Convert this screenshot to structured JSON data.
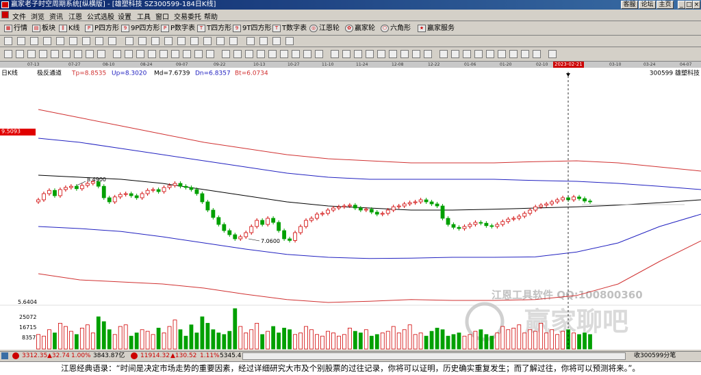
{
  "window": {
    "title": "赢家老子时空周期系统[纵横版] - [雄塑科技  SZ300599-184日K线]",
    "right_buttons": [
      "客服",
      "论坛",
      "主页"
    ],
    "controls": [
      "_",
      "□",
      "×"
    ]
  },
  "menu": [
    "文件",
    "浏览",
    "资讯",
    "江恩",
    "公式选股",
    "设置",
    "工具",
    "窗口",
    "交易委托",
    "帮助"
  ],
  "toolbar1": [
    {
      "icon": "table-icon",
      "label": "行情"
    },
    {
      "icon": "blocks-icon",
      "label": "板块"
    },
    {
      "icon": "kline-icon",
      "label": "K线"
    },
    {
      "icon": "p-square-icon",
      "label": "P四方形"
    },
    {
      "icon": "9p-square-icon",
      "label": "9P四方形"
    },
    {
      "icon": "p-table-icon",
      "label": "P数字表"
    },
    {
      "icon": "t-square-icon",
      "label": "T四方形"
    },
    {
      "icon": "9t-square-icon",
      "label": "9T四方形"
    },
    {
      "icon": "t-table-icon",
      "label": "T数字表"
    },
    {
      "icon": "gann-wheel-icon",
      "label": "江恩轮"
    },
    {
      "icon": "winner-wheel-icon",
      "label": "赢家轮"
    },
    {
      "icon": "hexagon-icon",
      "label": "六角形"
    },
    {
      "icon": "service-icon",
      "label": "赢家服务"
    }
  ],
  "dates": [
    "07-13",
    "07-27",
    "08-10",
    "08-24",
    "09-07",
    "09-22",
    "10-13",
    "10-27",
    "11-10",
    "11-24",
    "12-08",
    "12-22",
    "01-06",
    "01-20",
    "02-10",
    "2023-02-21",
    "03-10",
    "03-24",
    "04-07"
  ],
  "chart_data": {
    "type": "candlestick",
    "period_label": "日K线",
    "indicator": "极反通道",
    "values": {
      "Tp": "Tp=8.8535",
      "Up": "Up=8.3020",
      "Md": "Md=7.6739",
      "Dn": "Dn=6.8357",
      "Bt": "Bt=6.0734"
    },
    "stock": "300599  雄塑科技",
    "cursor_date": "2023-02-21",
    "price_tag": "9.5093",
    "high_label": "8.4900",
    "low_label": "7.0600",
    "volume_labels": [
      "25072",
      "16715",
      "8357"
    ],
    "volume_axis_top": "5.6404",
    "colors": {
      "up": "#d00000",
      "down": "#00a000",
      "tp": "#d03030",
      "up_line": "#2020c0",
      "md": "#000000"
    },
    "closes": [
      8.05,
      8.2,
      8.28,
      8.15,
      8.3,
      8.35,
      8.38,
      8.32,
      8.4,
      8.45,
      8.49,
      8.38,
      8.1,
      8.0,
      8.12,
      8.18,
      8.2,
      8.15,
      8.1,
      8.2,
      8.28,
      8.3,
      8.25,
      8.35,
      8.4,
      8.45,
      8.38,
      8.35,
      8.3,
      8.2,
      8.0,
      7.8,
      7.62,
      7.45,
      7.3,
      7.2,
      7.1,
      7.15,
      7.25,
      7.4,
      7.55,
      7.45,
      7.6,
      7.5,
      7.3,
      7.1,
      7.06,
      7.25,
      7.4,
      7.55,
      7.6,
      7.7,
      7.72,
      7.8,
      7.85,
      7.88,
      7.9,
      7.92,
      7.85,
      7.8,
      7.82,
      7.75,
      7.7,
      7.72,
      7.8,
      7.88,
      7.9,
      7.95,
      7.98,
      8.0,
      8.05,
      8.0,
      7.95,
      7.9,
      7.6,
      7.45,
      7.38,
      7.35,
      7.4,
      7.45,
      7.5,
      7.48,
      7.42,
      7.4,
      7.45,
      7.52,
      7.58,
      7.6,
      7.65,
      7.72,
      7.8,
      7.88,
      7.92,
      7.95,
      8.0,
      8.05,
      8.1,
      8.05,
      8.12,
      8.08,
      8.02,
      8.0
    ],
    "volumes": [
      9000,
      8000,
      12000,
      10000,
      16000,
      14000,
      11000,
      9000,
      13000,
      15000,
      10000,
      20000,
      17000,
      12000,
      9000,
      14000,
      15000,
      8000,
      10000,
      12000,
      11000,
      9000,
      13000,
      10000,
      14000,
      18000,
      12000,
      8000,
      15000,
      10000,
      20000,
      16000,
      12000,
      10000,
      9000,
      11000,
      25072,
      14000,
      10000,
      12000,
      16000,
      9000,
      11000,
      14000,
      10000,
      13000,
      12000,
      9000,
      10000,
      14000,
      12000,
      9000,
      8000,
      11000,
      10000,
      8000,
      9000,
      13000,
      11000,
      10000,
      12000,
      8000,
      9000,
      10000,
      11000,
      14000,
      10000,
      12000,
      15000,
      9000,
      10000,
      8000,
      11000,
      13000,
      12000,
      8000,
      9000,
      10000,
      8000,
      9000,
      11000,
      12000,
      9000,
      8000,
      10000,
      14000,
      12000,
      13000,
      15000,
      10000,
      12000,
      11000,
      16000,
      10000,
      12000,
      9000,
      11000,
      12000,
      10000,
      9000,
      10000,
      9000
    ]
  },
  "watermark": {
    "text1": "江恩工具软件  QQ:100800360",
    "text2": "赢家聊吧"
  },
  "status": {
    "sh": "3312.35",
    "sh_chg": "▲32.74",
    "sh_pct": "1.00%",
    "sh_amt": "3843.87亿",
    "sz": "11914.32",
    "sz_chg": "▲130.52",
    "sz_pct": "1.11%",
    "sz_amt": "5345.4",
    "right": "收300599分笔"
  },
  "quote": "江恩经典语录：“时间是决定市场走势的重要因素，经过详细研究大市及个别股票的过往记录，你将可以证明，历史确实重复发生；而了解过往，你将可以预测将来。”。"
}
